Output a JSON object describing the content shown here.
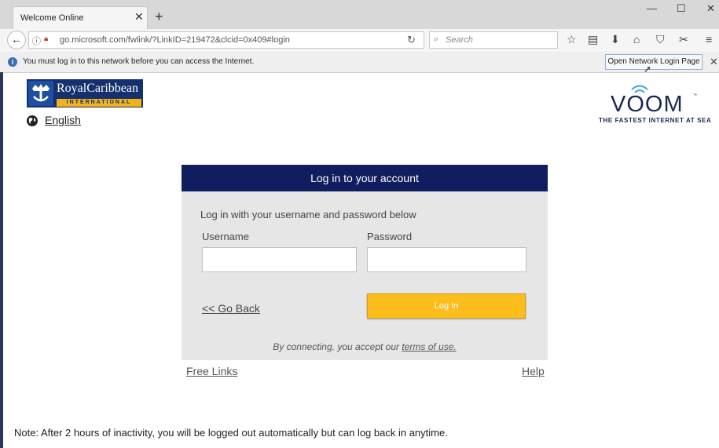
{
  "browser": {
    "tab_title": "Welcome Online",
    "url": "go.microsoft.com/fwlink/?LinkID=219472&clcid=0x409#login",
    "search_placeholder": "Search",
    "notification": "You must log in to this network before you can access the Internet.",
    "notification_button": "Open Network Login Page"
  },
  "header": {
    "brand_name": "RoyalCaribbean",
    "brand_sub": "INTERNATIONAL",
    "language": "English",
    "voom_name": "VOOM",
    "voom_tagline": "THE FASTEST INTERNET AT SEA"
  },
  "login": {
    "title": "Log in to your account",
    "intro": "Log in with your username and password below",
    "username_label": "Username",
    "password_label": "Password",
    "username_value": "",
    "password_value": "",
    "go_back": "<< Go Back",
    "login_button": "Log In",
    "terms_prefix": "By connecting, you accept our",
    "terms_link": "terms of use."
  },
  "footer": {
    "free_links": "Free Links",
    "help": "Help",
    "note": "Note: After 2 hours of inactivity, you will be logged out automatically but can log back in anytime."
  },
  "colors": {
    "header_navy": "#101d5e",
    "login_yellow": "#fdbe1b",
    "card_gray": "#e6e6e6"
  }
}
